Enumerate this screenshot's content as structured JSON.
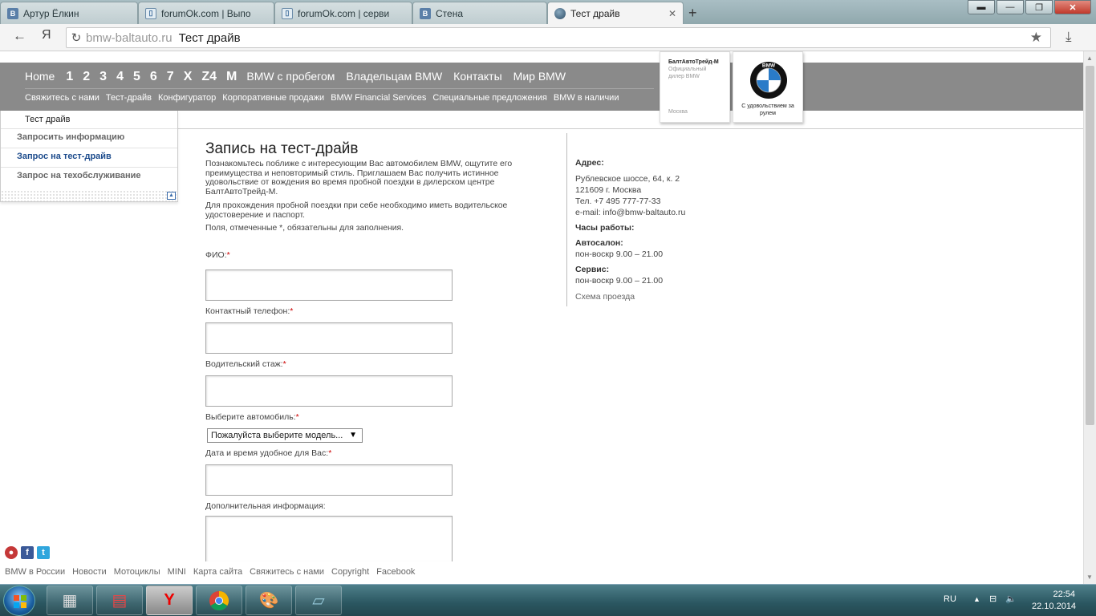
{
  "browser": {
    "tabs": [
      {
        "title": "Артур Ёлкин",
        "icon": "vk-icon"
      },
      {
        "title": "forumOk.com | Выпо",
        "icon": "forum-icon"
      },
      {
        "title": "forumOk.com | серви",
        "icon": "forum-icon"
      },
      {
        "title": "Стена",
        "icon": "vk-icon"
      },
      {
        "title": "Тест драйв",
        "icon": "globe-icon",
        "active": true
      }
    ],
    "new_tab": "+",
    "address_domain": "bmw-baltauto.ru",
    "address_title": "Тест драйв",
    "yandex_letter": "Я"
  },
  "site": {
    "top_nav": [
      {
        "label": "Home",
        "style": "txt"
      },
      {
        "label": "1",
        "style": "num"
      },
      {
        "label": "2",
        "style": "num"
      },
      {
        "label": "3",
        "style": "num"
      },
      {
        "label": "4",
        "style": "num"
      },
      {
        "label": "5",
        "style": "num"
      },
      {
        "label": "6",
        "style": "num"
      },
      {
        "label": "7",
        "style": "num"
      },
      {
        "label": "X",
        "style": "num"
      },
      {
        "label": "Z4",
        "style": "num"
      },
      {
        "label": "M",
        "style": "num"
      },
      {
        "label": "BMW с пробегом",
        "style": "txt"
      },
      {
        "label": "Владельцам BMW",
        "style": "txt"
      },
      {
        "label": "Контакты",
        "style": "txt"
      },
      {
        "label": "Мир BMW",
        "style": "txt"
      }
    ],
    "sub_nav": [
      "Свяжитесь с нами",
      "Тест-драйв",
      "Конфигуратор",
      "Корпоративные продажи",
      "BMW Financial Services",
      "Специальные предложения",
      "BMW в наличии"
    ],
    "dealer": {
      "name": "БалтАвтоТрейд-М",
      "subtitle": "Официальный дилер BMW",
      "city": "Москва"
    },
    "logo": {
      "letters": "BMW",
      "slogan": "С удовольствием за рулем"
    },
    "side_menu": {
      "header": "Тест драйв",
      "items": [
        "Запросить информацию",
        "Запрос на тест-драйв",
        "Запрос на техобслуживание"
      ],
      "active_index": 1,
      "collapse": "▲"
    },
    "form": {
      "title": "Запись на тест-драйв",
      "intro": "Познакомьтесь поближе с интересующим Вас автомобилем BMW, ощутите его преимущества и неповторимый стиль. Приглашаем Вас получить истинное удовольствие от вождения во время пробной поездки в дилерском центре БалтАвтоТрейд-М.",
      "note": "Для прохождения пробной поездки при себе необходимо иметь водительское удостоверение и паспорт.",
      "required_note": "Поля, отмеченные *, обязательны для заполнения.",
      "fields": {
        "fio": "ФИО:",
        "phone": "Контактный телефон:",
        "experience": "Водительский стаж:",
        "car": "Выберите автомобиль:",
        "datetime": "Дата и время удобное для Вас:",
        "extra": "Дополнительная информация:"
      },
      "required_mark": "*",
      "car_select_value": "Пожалуйста выберите модель...",
      "select_arrow": "▼"
    },
    "contacts": {
      "address_label": "Адрес:",
      "street": "Рублевское шоссе, 64, к. 2",
      "city_line": "121609 г. Москва",
      "phone": "Тел. +7 495 777-77-33",
      "email": "e-mail: info@bmw-baltauto.ru",
      "hours_label": "Часы работы:",
      "salon_label": "Автосалон:",
      "salon_hours": "пон-воскр 9.00 – 21.00",
      "service_label": "Сервис:",
      "service_hours": "пон-воскр 9.00 – 21.00",
      "map_link": "Схема проезда"
    },
    "social": [
      "youtube-icon",
      "facebook-icon",
      "twitter-icon"
    ],
    "footer": [
      "BMW в России",
      "Новости",
      "Мотоциклы",
      "MINI",
      "Карта сайта",
      "Свяжитесь с нами",
      "Copyright",
      "Facebook"
    ]
  },
  "taskbar": {
    "apps": [
      "calculator-icon",
      "floppy-icon",
      "yandex-browser-icon",
      "chrome-icon",
      "paint-icon",
      "notepad-icon"
    ],
    "lang": "RU",
    "time": "22:54",
    "date": "22.10.2014"
  },
  "colors": {
    "header_gray": "#8a8a8a",
    "active_link": "#1c4b8c",
    "required": "#cc0000"
  }
}
